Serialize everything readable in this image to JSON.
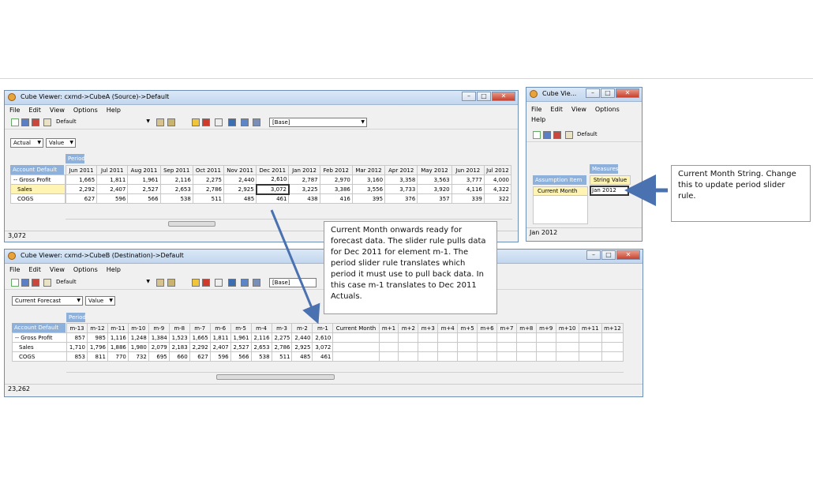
{
  "cubeA": {
    "title": "Cube Viewer: cxmd->CubeA (Source)->Default",
    "menu": [
      "File",
      "Edit",
      "View",
      "Options",
      "Help"
    ],
    "view": "Default",
    "base": "[Base]",
    "filters": [
      "Actual",
      "Value"
    ],
    "period_label": "Period",
    "row_dim": "Account Default",
    "columns": [
      "Jun 2011",
      "Jul 2011",
      "Aug 2011",
      "Sep 2011",
      "Oct 2011",
      "Nov 2011",
      "Dec 2011",
      "Jan 2012",
      "Feb 2012",
      "Mar 2012",
      "Apr 2012",
      "May 2012",
      "Jun 2012",
      "Jul 2012"
    ],
    "rows": [
      {
        "label": "-- Gross Profit",
        "values": [
          "1,665",
          "1,811",
          "1,961",
          "2,116",
          "2,275",
          "2,440",
          "2,610",
          "2,787",
          "2,970",
          "3,160",
          "3,358",
          "3,563",
          "3,777",
          "4,000"
        ]
      },
      {
        "label": "Sales",
        "values": [
          "2,292",
          "2,407",
          "2,527",
          "2,653",
          "2,786",
          "2,925",
          "3,072",
          "3,225",
          "3,386",
          "3,556",
          "3,733",
          "3,920",
          "4,116",
          "4,322"
        ]
      },
      {
        "label": "COGS",
        "values": [
          "627",
          "596",
          "566",
          "538",
          "511",
          "485",
          "461",
          "438",
          "416",
          "395",
          "376",
          "357",
          "339",
          "322"
        ]
      }
    ],
    "status": "3,072"
  },
  "cubeB": {
    "title": "Cube Viewer: cxmd->CubeB (Destination)->Default",
    "menu": [
      "File",
      "Edit",
      "View",
      "Options",
      "Help"
    ],
    "view": "Default",
    "base": "[Base]",
    "filters": [
      "Current Forecast",
      "Value"
    ],
    "period_label": "Period",
    "row_dim": "Account Default",
    "columns": [
      "m-13",
      "m-12",
      "m-11",
      "m-10",
      "m-9",
      "m-8",
      "m-7",
      "m-6",
      "m-5",
      "m-4",
      "m-3",
      "m-2",
      "m-1",
      "Current Month",
      "m+1",
      "m+2",
      "m+3",
      "m+4",
      "m+5",
      "m+6",
      "m+7",
      "m+8",
      "m+9",
      "m+10",
      "m+11",
      "m+12"
    ],
    "rows": [
      {
        "label": "-- Gross Profit",
        "values": [
          "857",
          "985",
          "1,116",
          "1,248",
          "1,384",
          "1,523",
          "1,665",
          "1,811",
          "1,961",
          "2,116",
          "2,275",
          "2,440",
          "2,610",
          "",
          "",
          "",
          "",
          "",
          "",
          "",
          "",
          "",
          "",
          "",
          "",
          ""
        ]
      },
      {
        "label": "Sales",
        "values": [
          "1,710",
          "1,796",
          "1,886",
          "1,980",
          "2,079",
          "2,183",
          "2,292",
          "2,407",
          "2,527",
          "2,653",
          "2,786",
          "2,925",
          "3,072",
          "",
          "",
          "",
          "",
          "",
          "",
          "",
          "",
          "",
          "",
          "",
          "",
          ""
        ]
      },
      {
        "label": "COGS",
        "values": [
          "853",
          "811",
          "770",
          "732",
          "695",
          "660",
          "627",
          "596",
          "566",
          "538",
          "511",
          "485",
          "461",
          "",
          "",
          "",
          "",
          "",
          "",
          "",
          "",
          "",
          "",
          "",
          "",
          ""
        ]
      }
    ],
    "status": "23,262"
  },
  "small": {
    "title": "Cube Vie...",
    "menu": [
      "File",
      "Edit",
      "View",
      "Options",
      "Help"
    ],
    "view": "Default",
    "col_dim": "Measures",
    "row_dim": "Assumption Item",
    "col_header": "String Value",
    "row_label": "Current Month",
    "value": "Jan 2012",
    "status": "Jan 2012"
  },
  "callout1": "Current Month String. Change this to update period slider rule.",
  "callout2": "Current Month onwards ready for forecast data.  The slider rule pulls data for Dec 2011  for element  m-1. The period slider rule translates which period it must use to pull back data. In this case m-1 translates to Dec 2011  Actuals.",
  "colors": {
    "arrow": "#4a72b0",
    "highlight": "#fff4b3",
    "dim_header": "#8eb1db"
  }
}
